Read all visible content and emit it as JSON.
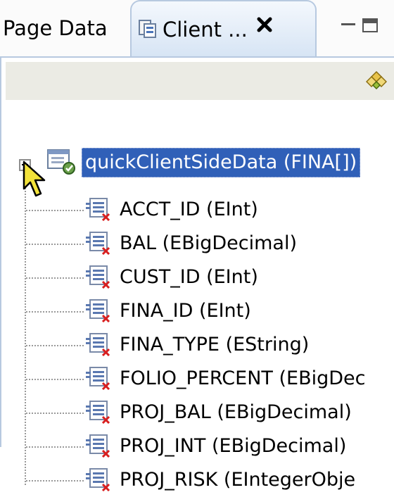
{
  "tabs": [
    {
      "label": "Page Data"
    },
    {
      "label": "Client ..."
    }
  ],
  "tree": {
    "root": {
      "label": "quickClientSideData (FINA[])"
    },
    "items": [
      {
        "label": "ACCT_ID (EInt)"
      },
      {
        "label": "BAL (EBigDecimal)"
      },
      {
        "label": "CUST_ID (EInt)"
      },
      {
        "label": "FINA_ID (EInt)"
      },
      {
        "label": "FINA_TYPE (EString)"
      },
      {
        "label": "FOLIO_PERCENT (EBigDec"
      },
      {
        "label": "PROJ_BAL (EBigDecimal)"
      },
      {
        "label": "PROJ_INT (EBigDecimal)"
      },
      {
        "label": "PROJ_RISK (EIntegerObje"
      }
    ]
  },
  "colors": {
    "selection": "#3060b8",
    "tab_active_border": "#b7c9e0",
    "toolbar": "#ebebe4"
  }
}
